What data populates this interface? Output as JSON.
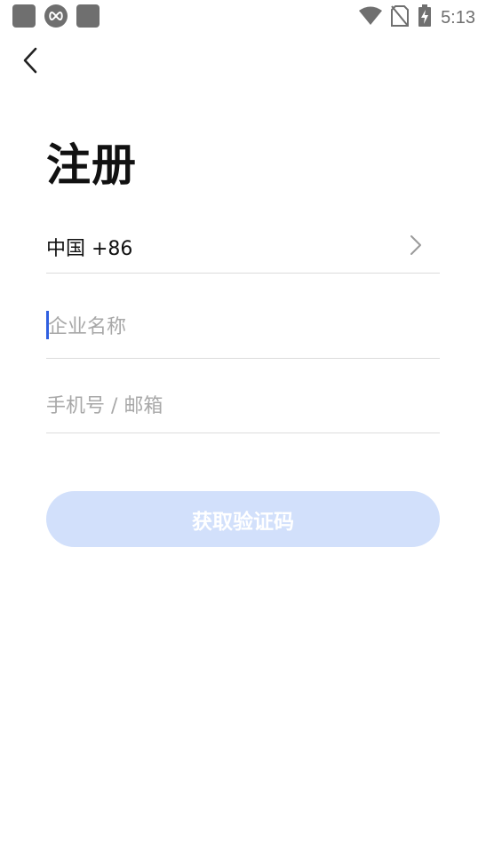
{
  "status_bar": {
    "time": "5:13",
    "icons": [
      "app-square-icon",
      "infinity-icon",
      "app-square-icon",
      "wifi-icon",
      "no-sim-icon",
      "battery-charging-icon"
    ]
  },
  "header": {
    "back_icon": "chevron-left-icon"
  },
  "title": "注册",
  "form": {
    "country_code_label": "中国 +86",
    "company_name_placeholder": "企业名称",
    "phone_email_placeholder": "手机号 / 邮箱"
  },
  "actions": {
    "get_code_label": "获取验证码"
  },
  "colors": {
    "accent": "#2f5fe0",
    "button_disabled_bg": "#d2e0fb",
    "divider": "#dcdcdc",
    "placeholder": "#a8a8a8"
  }
}
